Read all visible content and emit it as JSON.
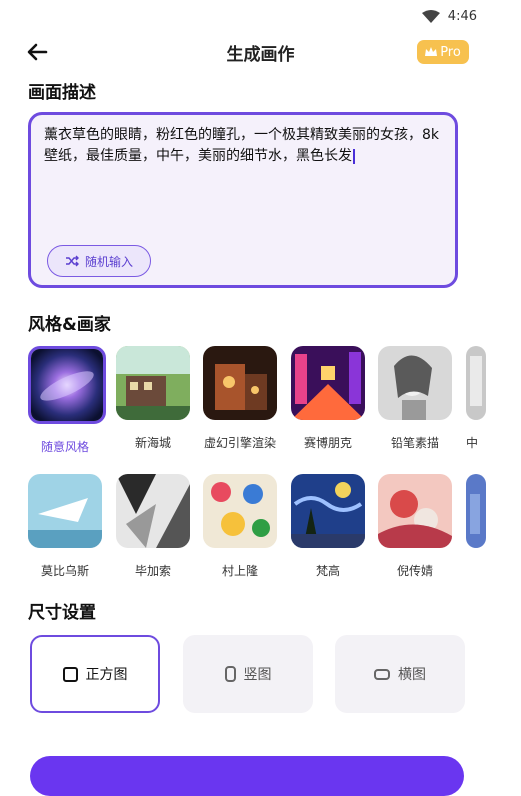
{
  "status": {
    "time": "4:46"
  },
  "header": {
    "title": "生成画作",
    "pro_label": "Pro"
  },
  "description": {
    "section_title": "画面描述",
    "text": "薰衣草色的眼睛，粉红色的瞳孔，一个极其精致美丽的女孩，8k壁纸，最佳质量，中午，美丽的细节水，黑色长发",
    "random_button": "随机输入"
  },
  "styles": {
    "section_title": "风格&画家",
    "row1": [
      {
        "label": "随意风格",
        "selected": true
      },
      {
        "label": "新海城"
      },
      {
        "label": "虚幻引擎渲染"
      },
      {
        "label": "赛博朋克"
      },
      {
        "label": "铅笔素描"
      },
      {
        "label": "中"
      }
    ],
    "row2": [
      {
        "label": "莫比乌斯"
      },
      {
        "label": "毕加索"
      },
      {
        "label": "村上隆"
      },
      {
        "label": "梵高"
      },
      {
        "label": "倪传婧"
      }
    ]
  },
  "size": {
    "section_title": "尺寸设置",
    "options": [
      {
        "label": "正方图",
        "selected": true
      },
      {
        "label": "竖图"
      },
      {
        "label": "横图"
      }
    ]
  },
  "colors": {
    "accent": "#6e4bdf",
    "pro": "#f7c14f"
  }
}
